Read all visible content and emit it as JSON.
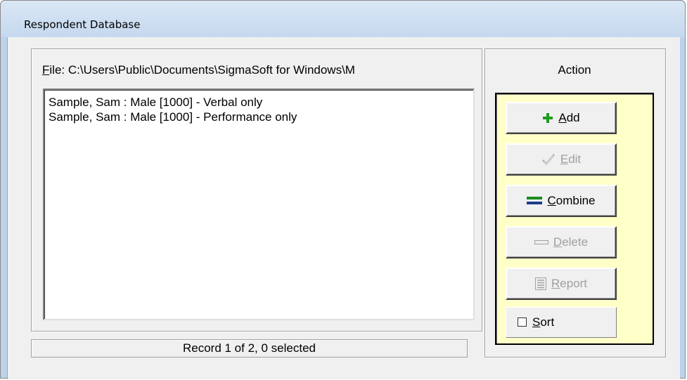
{
  "window": {
    "title": "Respondent Database"
  },
  "file": {
    "label_accel": "F",
    "label_rest": "ile: C:\\Users\\Public\\Documents\\SigmaSoft for Windows\\M"
  },
  "list": {
    "items": [
      "Sample, Sam : Male [1000] - Verbal only",
      "Sample, Sam : Male [1000] - Performance only"
    ]
  },
  "status": {
    "text": "Record 1 of 2, 0 selected"
  },
  "action": {
    "title": "Action",
    "panel_color": "#ffffc8",
    "buttons": {
      "add": {
        "accel": "A",
        "rest": "dd",
        "icon": "plus-icon",
        "enabled": true
      },
      "edit": {
        "accel": "E",
        "rest": "dit",
        "icon": "checkmark-icon",
        "enabled": false
      },
      "combine": {
        "accel": "C",
        "rest": "ombine",
        "icon": "equals-icon",
        "enabled": true
      },
      "delete": {
        "accel": "D",
        "rest": "elete",
        "icon": "minus-icon",
        "enabled": false
      },
      "report": {
        "accel": "R",
        "rest": "eport",
        "icon": "document-icon",
        "enabled": false
      }
    },
    "sort": {
      "accel": "S",
      "rest": "ort",
      "checked": false
    }
  },
  "colors": {
    "plus_icon": "#1e9c1e",
    "equals_icon_top": "#1e8c1e",
    "equals_icon_bottom": "#1e3c8c",
    "disabled_text": "#a0a0a0"
  }
}
